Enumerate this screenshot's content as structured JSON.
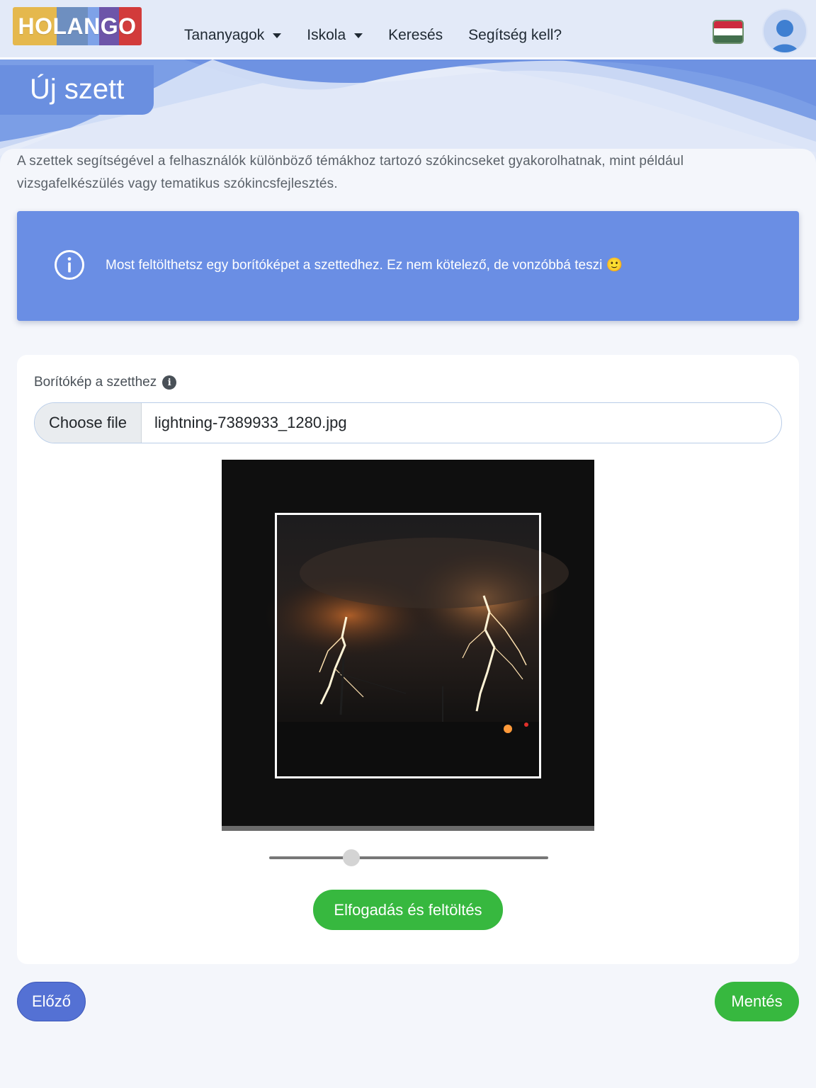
{
  "header": {
    "logo_text": "HOLANGO",
    "logo_colors": [
      "#e5b84d",
      "#6e8fc0",
      "#7ea2e8",
      "#6d55a9",
      "#d23b3b"
    ],
    "nav": [
      {
        "label": "Tananyagok",
        "has_dropdown": true
      },
      {
        "label": "Iskola",
        "has_dropdown": true
      },
      {
        "label": "Keresés",
        "has_dropdown": false
      },
      {
        "label": "Segítség kell?",
        "has_dropdown": false
      }
    ],
    "language_flag": "hungarian-flag",
    "flag_colors": [
      "#cd2a3e",
      "#ffffff",
      "#436f4d"
    ],
    "avatar_icon": "user-avatar-icon"
  },
  "page": {
    "title": "Új szett",
    "intro": "A szettek segítségével a felhasználók különböző témákhoz tartozó szókincseket gyakorolhatnak, mint például vizsgafelkészülés vagy tematikus szókincsfejlesztés."
  },
  "alert": {
    "icon": "info-circle-icon",
    "text": "Most feltölthetsz egy borítóképet a szettedhez. Ez nem kötelező, de vonzóbbá teszi 🙂",
    "background": "#6a8ee4"
  },
  "cover_form": {
    "label": "Borítókép a szetthez",
    "label_icon": "info-icon",
    "choose_file_label": "Choose file",
    "file_name": "lightning-7389933_1280.jpg",
    "zoom_level": 0.28
  },
  "buttons": {
    "accept_upload": "Elfogadás és feltöltés",
    "previous": "Előző",
    "save": "Mentés"
  },
  "colors": {
    "accent_blue": "#6a8fe0",
    "success_green": "#37b83f",
    "previous_blue": "#5471d4"
  }
}
